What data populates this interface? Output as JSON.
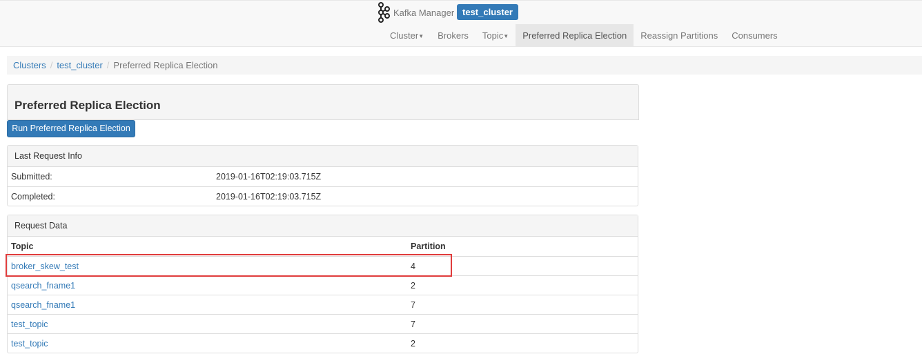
{
  "navbar": {
    "brand": "Kafka Manager",
    "cluster": "test_cluster",
    "items": [
      {
        "label": "Cluster",
        "dropdown": true
      },
      {
        "label": "Brokers",
        "dropdown": false
      },
      {
        "label": "Topic",
        "dropdown": true
      },
      {
        "label": "Preferred Replica Election",
        "dropdown": false,
        "active": true
      },
      {
        "label": "Reassign Partitions",
        "dropdown": false
      },
      {
        "label": "Consumers",
        "dropdown": false
      }
    ]
  },
  "breadcrumb": [
    "Clusters",
    "test_cluster",
    "Preferred Replica Election"
  ],
  "page_title": "Preferred Replica Election",
  "run_button": "Run Preferred Replica Election",
  "last_request": {
    "heading": "Last Request Info",
    "rows": [
      {
        "label": "Submitted:",
        "value": "2019-01-16T02:19:03.715Z"
      },
      {
        "label": "Completed:",
        "value": "2019-01-16T02:19:03.715Z"
      }
    ]
  },
  "request_data": {
    "heading": "Request Data",
    "columns": [
      "Topic",
      "Partition"
    ],
    "rows": [
      {
        "topic": "broker_skew_test",
        "partition": "4"
      },
      {
        "topic": "qsearch_fname1",
        "partition": "2"
      },
      {
        "topic": "qsearch_fname1",
        "partition": "7"
      },
      {
        "topic": "test_topic",
        "partition": "7"
      },
      {
        "topic": "test_topic",
        "partition": "2"
      }
    ]
  },
  "colors": {
    "primary": "#337ab7",
    "highlight": "#e03c3c"
  }
}
